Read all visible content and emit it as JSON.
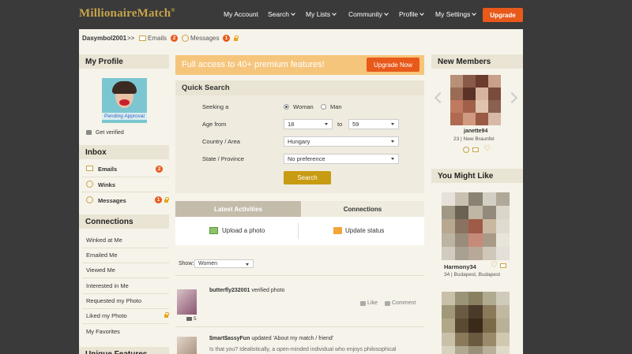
{
  "brand": {
    "logo": "MillionaireMatch",
    "reg": "®"
  },
  "nav": {
    "account": "My Account",
    "search": "Search",
    "lists": "My Lists",
    "community": "Community",
    "profile": "Profile",
    "settings": "My Settings",
    "upgrade": "Upgrade"
  },
  "breadcrumb": {
    "user": "Dasymbol2001",
    "sep": ">>",
    "emails": "Emails",
    "emails_count": "2",
    "messages": "Messages",
    "messages_count": "1"
  },
  "my_profile": {
    "title": "My Profile",
    "pending": "Pending Approval",
    "verified": "Get verified"
  },
  "inbox": {
    "title": "Inbox",
    "emails": "Emails",
    "emails_count": "2",
    "winks": "Winks",
    "messages": "Messages",
    "messages_count": "1"
  },
  "connections": {
    "title": "Connections",
    "items": [
      "Winked at Me",
      "Emailed Me",
      "Viewed Me",
      "Interested in Me",
      "Requested my Photo",
      "Liked my Photo",
      "My Favorites"
    ]
  },
  "unique_features": {
    "title": "Unique Features"
  },
  "banner": {
    "text": "Full access to 40+ premium features!",
    "button": "Upgrade Now"
  },
  "quick_search": {
    "title": "Quick Search",
    "seeking_label": "Seeking a",
    "woman": "Woman",
    "man": "Man",
    "age_label": "Age from",
    "age_from": "18",
    "age_to_label": "to",
    "age_to": "59",
    "country_label": "Country / Area",
    "country": "Hungary",
    "state_label": "State / Province",
    "state": "No preference",
    "button": "Search"
  },
  "activity_tabs": {
    "latest": "Latest Activities",
    "connections": "Connections"
  },
  "actions": {
    "upload": "Upload a photo",
    "status": "Update status"
  },
  "feed": {
    "show_label": "Show:",
    "show_value": "Women",
    "items": [
      {
        "user": "butterfly232001",
        "action": "verified photo",
        "photos": "5",
        "like": "Like",
        "comment": "Comment"
      },
      {
        "user": "$mart$assyFun",
        "action": "updated 'About my match / friend'",
        "excerpt": "Is that you? Idealistically, a open-minded individual who enjoys philosophical"
      }
    ]
  },
  "new_members": {
    "title": "New Members",
    "name": "janette94",
    "meta": "23 | New Braunfel"
  },
  "you_might_like": {
    "title": "You Might Like",
    "name": "Harmony34",
    "meta": "34 | Budapest, Budapest"
  }
}
